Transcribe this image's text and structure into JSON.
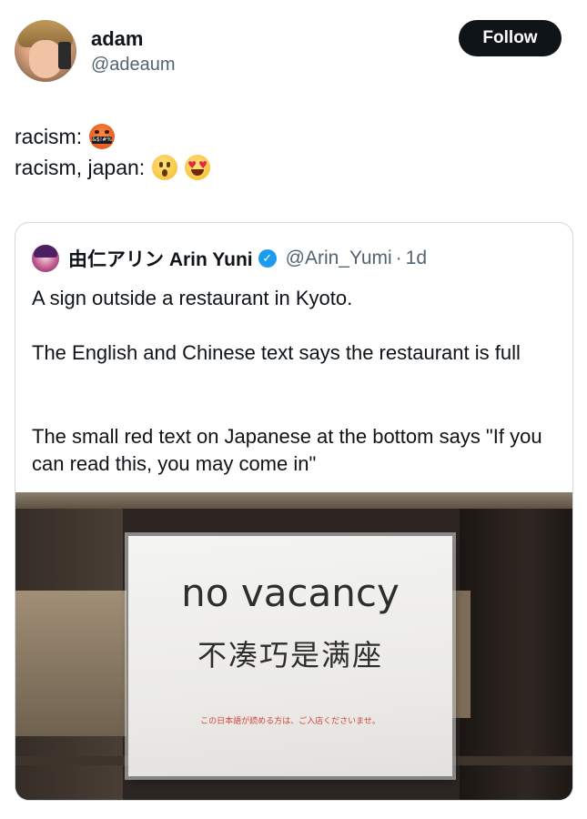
{
  "author": {
    "display_name": "adam",
    "handle": "@adeaum",
    "avatar_icon": "profile-photo"
  },
  "follow_button": {
    "label": "Follow",
    "background": "#0f1419",
    "text_color": "#ffffff"
  },
  "tweet": {
    "line1": {
      "text": "racism:",
      "emojis": [
        "face-with-symbols-on-mouth"
      ]
    },
    "line2": {
      "text": "racism, japan:",
      "emojis": [
        "face-with-open-mouth",
        "smiling-face-with-heart-eyes"
      ]
    }
  },
  "quoted_tweet": {
    "display_name": "由仁アリン Arin Yuni",
    "verified": true,
    "verified_color": "#1d9bf0",
    "handle": "@Arin_Yumi",
    "separator": "·",
    "time": "1d",
    "paragraphs": [
      "A sign outside a restaurant in Kyoto.",
      "The English and Chinese text says the restaurant is full",
      "The small red text on Japanese at the bottom says \"If you can read this, you may come in\""
    ],
    "photo": {
      "sign_english": "no vacancy",
      "sign_chinese": "不凑巧是满座",
      "sign_japanese": "この日本語が読める方は、ご入店くださいませ。",
      "sign_japanese_color": "#d2453a"
    }
  }
}
